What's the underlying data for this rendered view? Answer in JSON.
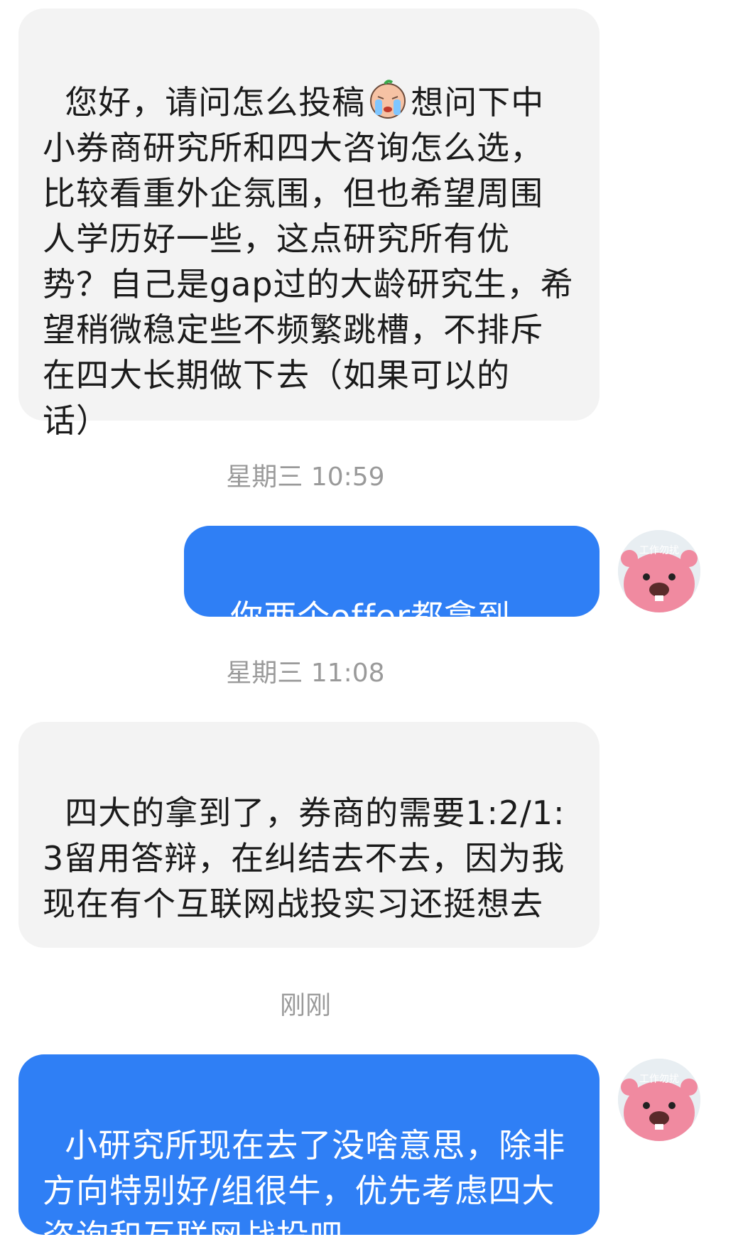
{
  "colors": {
    "outgoing_bubble": "#2f7ff5",
    "incoming_bubble": "#f3f3f3",
    "timestamp": "#9a9a9a"
  },
  "messages": [
    {
      "direction": "incoming",
      "text_before_emoji": "您好，请问怎么投稿",
      "emoji": "crying-face-emoji",
      "text_after_emoji": "想问下中小券商研究所和四大咨询怎么选，比较看重外企氛围，但也希望周围人学历好一些，这点研究所有优势？自己是gap过的大龄研究生，希望稍微稳定些不频繁跳槽，不排斥在四大长期做下去（如果可以的话）"
    },
    {
      "timestamp": "星期三 10:59"
    },
    {
      "direction": "outgoing",
      "text": "你两个offer都拿到了？",
      "avatar_badge": "工作勿扰"
    },
    {
      "timestamp": "星期三 11:08"
    },
    {
      "direction": "incoming",
      "text": "四大的拿到了，券商的需要1:2/1:3留用答辩，在纠结去不去，因为我现在有个互联网战投实习还挺想去"
    },
    {
      "timestamp": "刚刚"
    },
    {
      "direction": "outgoing",
      "text": "小研究所现在去了没啥意思，除非方向特别好/组很牛，优先考虑四大咨询和互联网战投吧",
      "avatar_badge": "工作勿扰"
    }
  ]
}
